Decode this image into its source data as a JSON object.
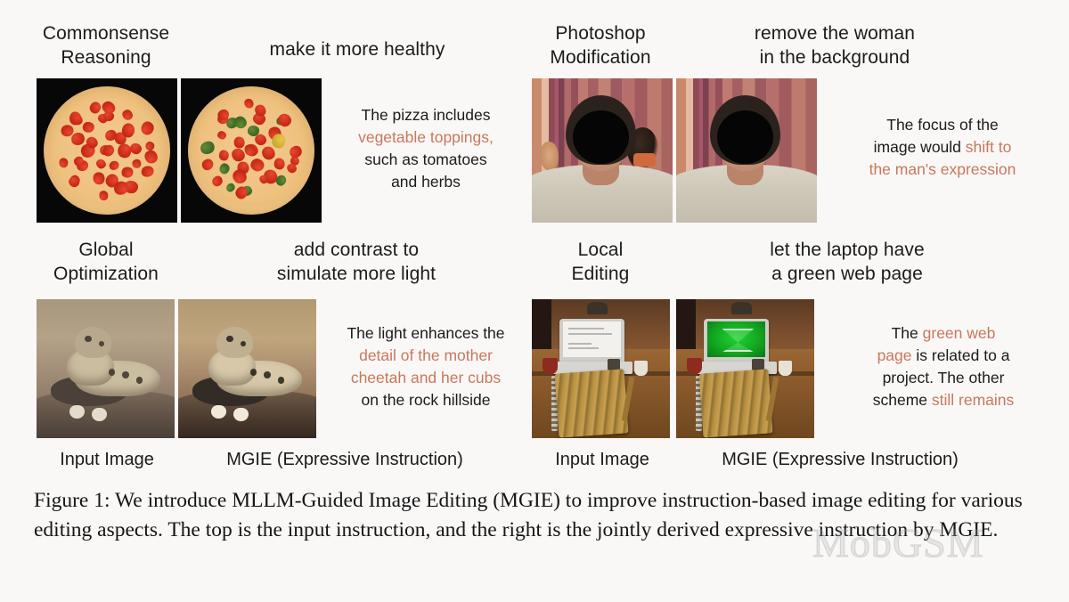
{
  "page": {
    "background": "#f9f8f7",
    "highlight_color": "#c8785c",
    "text_color": "#1b1b1b",
    "watermark": "MobGSM"
  },
  "panels": [
    {
      "id": "commonsense-reasoning",
      "aspect_label": "Commonsense\nReasoning",
      "instruction": "make it more healthy",
      "expressive_instruction": [
        {
          "text": "The pizza includes ",
          "highlight": false
        },
        {
          "text": "vegetable toppings",
          "highlight": true
        },
        {
          "text": ", such as tomatoes and herbs",
          "highlight": false
        }
      ],
      "expressive_lines": [
        "The pizza includes",
        "vegetable toppings,",
        "such as tomatoes",
        "and herbs"
      ],
      "input_image_alt": "pepperoni pizza on black background",
      "output_image_alt": "pizza with vegetable toppings on black background"
    },
    {
      "id": "photoshop-modification",
      "aspect_label": "Photoshop\nModification",
      "instruction": "remove the woman\nin the background",
      "expressive_instruction": [
        {
          "text": "The focus of the image would ",
          "highlight": false
        },
        {
          "text": "shift to the man's expression",
          "highlight": true
        }
      ],
      "expressive_lines": [
        "The focus of the",
        "image would shift to",
        "the man's expression"
      ],
      "input_image_alt": "man in front of red curtain with woman in background",
      "output_image_alt": "man in front of red curtain, woman removed"
    },
    {
      "id": "global-optimization",
      "aspect_label": "Global\nOptimization",
      "instruction": "add contrast to\nsimulate more light",
      "expressive_instruction": [
        {
          "text": "The light enhances the ",
          "highlight": false
        },
        {
          "text": "detail of the mother cheetah and her cubs",
          "highlight": true
        },
        {
          "text": " on the rock hillside",
          "highlight": false
        }
      ],
      "expressive_lines": [
        "The light enhances the",
        "detail of the mother",
        "cheetah and her cubs",
        "on the rock hillside"
      ],
      "input_image_alt": "cheetah with cubs on dry ground",
      "output_image_alt": "cheetah with cubs, higher contrast"
    },
    {
      "id": "local-editing",
      "aspect_label": "Local\nEditing",
      "instruction": "let the laptop have\na green web page",
      "expressive_instruction": [
        {
          "text": "The ",
          "highlight": false
        },
        {
          "text": "green web page",
          "highlight": true
        },
        {
          "text": " is related to a project. The other scheme ",
          "highlight": false
        },
        {
          "text": "still remains",
          "highlight": true
        }
      ],
      "expressive_lines": [
        "The green web",
        "page is related to a",
        "project. The other",
        "scheme still remains"
      ],
      "input_image_alt": "desk with laptop showing white web page",
      "output_image_alt": "desk with laptop showing green web page"
    }
  ],
  "column_captions": {
    "left_group": {
      "input": "Input Image",
      "output": "MGIE (Expressive Instruction)"
    },
    "right_group": {
      "input": "Input Image",
      "output": "MGIE (Expressive Instruction)"
    }
  },
  "figure_caption": {
    "label": "Figure 1:",
    "text": " We introduce MLLM-Guided Image Editing (MGIE) to improve instruction-based image editing for various editing aspects. The top is the input instruction, and the right is the jointly derived expressive instruction by MGIE."
  }
}
